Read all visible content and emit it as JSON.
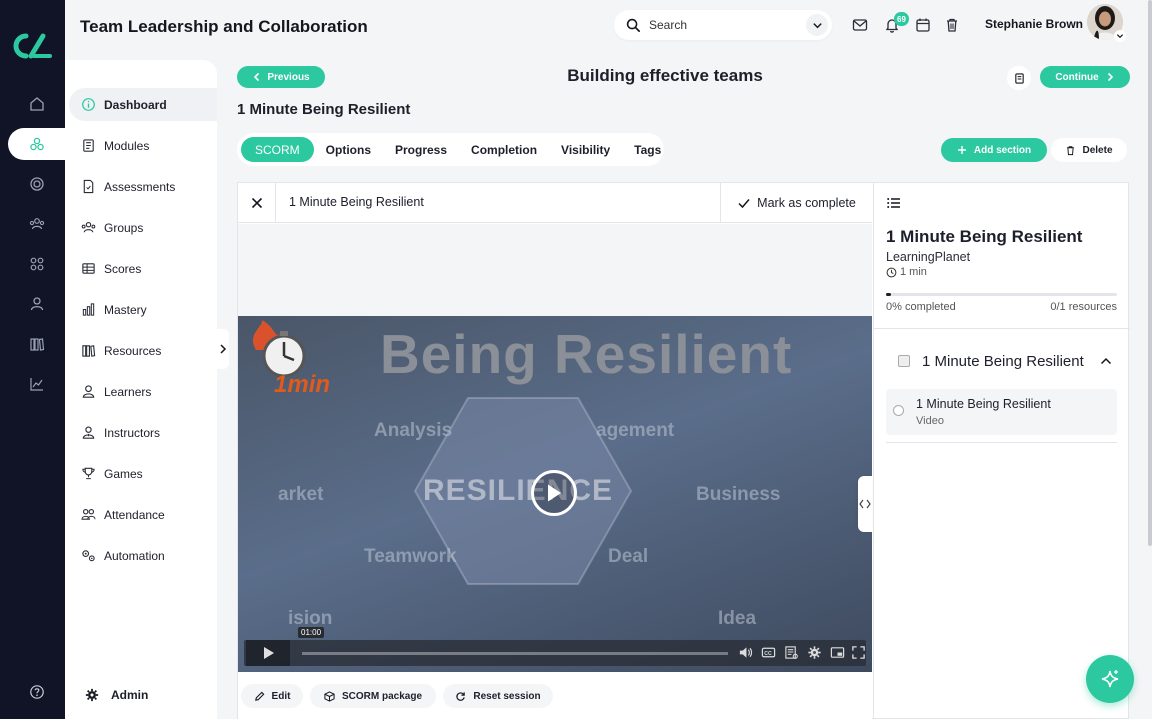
{
  "app": {
    "title": "Team Leadership and Collaboration"
  },
  "search": {
    "placeholder": "Search"
  },
  "header": {
    "notifications_count": "69",
    "user_name": "Stephanie Brown"
  },
  "sidebar": {
    "items": [
      {
        "label": "Dashboard",
        "icon": "info-icon",
        "active": true
      },
      {
        "label": "Modules",
        "icon": "book-icon"
      },
      {
        "label": "Assessments",
        "icon": "document-icon"
      },
      {
        "label": "Groups",
        "icon": "users-icon"
      },
      {
        "label": "Scores",
        "icon": "table-icon"
      },
      {
        "label": "Mastery",
        "icon": "bar-chart-icon"
      },
      {
        "label": "Resources",
        "icon": "library-icon"
      },
      {
        "label": "Learners",
        "icon": "person-icon"
      },
      {
        "label": "Instructors",
        "icon": "instructor-icon"
      },
      {
        "label": "Games",
        "icon": "trophy-icon"
      },
      {
        "label": "Attendance",
        "icon": "attendance-icon"
      },
      {
        "label": "Automation",
        "icon": "gears-icon"
      }
    ],
    "admin_label": "Admin"
  },
  "course": {
    "prev_label": "Previous",
    "title": "Building effective teams",
    "continue_label": "Continue",
    "unit_title": "1 Minute Being Resilient"
  },
  "tabs": [
    {
      "label": "SCORM",
      "active": true
    },
    {
      "label": "Options"
    },
    {
      "label": "Progress"
    },
    {
      "label": "Completion"
    },
    {
      "label": "Visibility"
    },
    {
      "label": "Tags"
    }
  ],
  "actions": {
    "add_section": "Add section",
    "delete": "Delete"
  },
  "player": {
    "title": "1 Minute Being Resilient",
    "mark_complete": "Mark as complete",
    "video": {
      "logo_text": "1min",
      "headline": "Being Resilient",
      "center_word": "RESILIENCE",
      "words": [
        "Analysis",
        "agement",
        "arket",
        "Business",
        "Teamwork",
        "Deal",
        "ision",
        "Idea"
      ],
      "time": "01:00"
    },
    "bottom": {
      "edit": "Edit",
      "scorm_package": "SCORM package",
      "reset_session": "Reset session"
    }
  },
  "panel": {
    "title": "1 Minute Being Resilient",
    "provider": "LearningPlanet",
    "duration": "1 min",
    "progress_pct": 2,
    "completed_text": "0% completed",
    "resources_text": "0/1 resources",
    "section_title": "1 Minute Being Resilient",
    "resource": {
      "name": "1 Minute Being Resilient",
      "type": "Video"
    }
  },
  "colors": {
    "accent": "#2cc8a0",
    "rail": "#101426"
  }
}
